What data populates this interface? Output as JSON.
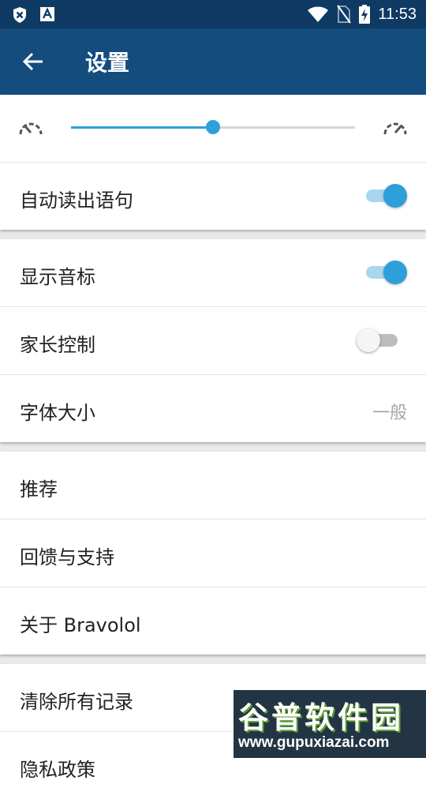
{
  "status_bar": {
    "time": "11:53"
  },
  "header": {
    "title": "设置"
  },
  "speed": {
    "level": 0.5
  },
  "group1": {
    "auto_read_label": "自动读出语句",
    "auto_read_on": true
  },
  "group2": {
    "phonetics_label": "显示音标",
    "phonetics_on": true,
    "parental_label": "家长控制",
    "parental_on": false,
    "font_size_label": "字体大小",
    "font_size_value": "一般"
  },
  "group3": {
    "recommend_label": "推荐",
    "feedback_label": "回馈与支持",
    "about_label": "关于 Bravolol"
  },
  "group4": {
    "clear_label": "清除所有记录",
    "privacy_label": "隐私政策"
  },
  "watermark": {
    "title": "谷普软件园",
    "url": "www.gupuxiazai.com"
  },
  "colors": {
    "appbar": "#144c7e",
    "statusbar": "#0e3a64",
    "accent": "#2e9fdb"
  }
}
